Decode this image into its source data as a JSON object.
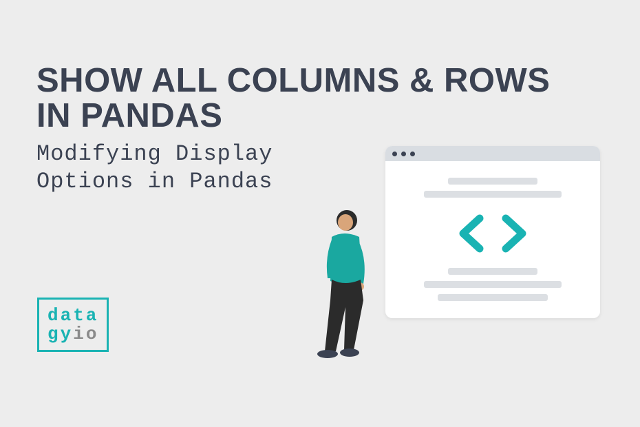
{
  "title": {
    "line1": "SHOW ALL COLUMNS & ROWS",
    "line2": "IN PANDAS"
  },
  "subtitle": {
    "line1": "Modifying Display",
    "line2": "Options in Pandas"
  },
  "logo": {
    "top": "data",
    "bottom_left": "gy",
    "bottom_right": "io"
  },
  "colors": {
    "teal": "#1ab3b3",
    "dark": "#3b4252",
    "bg": "#ededed"
  }
}
